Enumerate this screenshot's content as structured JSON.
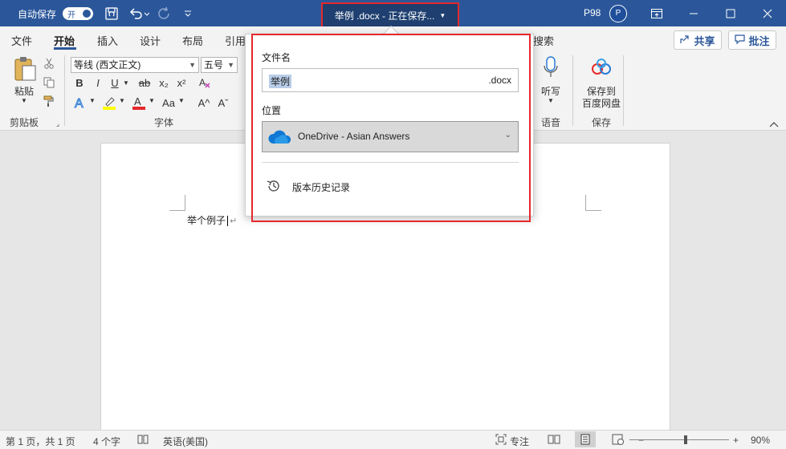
{
  "titlebar": {
    "autosave_label": "自动保存",
    "autosave_state": "开",
    "doc_title": "举例 .docx - 正在保存...",
    "user_name": "P98",
    "avatar_initial": "P"
  },
  "tabs": [
    "文件",
    "开始",
    "插入",
    "设计",
    "布局",
    "引用",
    "搜索"
  ],
  "active_tab": "开始",
  "share_label": "共享",
  "comment_label": "批注",
  "ribbon": {
    "paste_label": "粘贴",
    "clipboard_group": "剪贴板",
    "font_name": "等线 (西文正文)",
    "font_size": "五号",
    "font_group": "字体",
    "bold": "B",
    "italic": "I",
    "underline": "U",
    "strike": "ab",
    "subscript": "x₂",
    "superscript": "x²",
    "font_case": "Aa",
    "grow": "A^",
    "shrink": "Aˇ",
    "dictate_label": "听写",
    "voice_group": "语音",
    "baidu_save_line1": "保存到",
    "baidu_save_line2": "百度网盘",
    "save_group": "保存"
  },
  "popup": {
    "filename_label": "文件名",
    "filename_value": "举例",
    "filename_ext": ".docx",
    "location_label": "位置",
    "location_value": "OneDrive - Asian Answers",
    "history_label": "版本历史记录"
  },
  "document": {
    "text": "举个例子"
  },
  "statusbar": {
    "page": "第 1 页，共 1 页",
    "words": "4 个字",
    "language": "英语(美国)",
    "focus": "专注",
    "zoom": "90%",
    "zoom_percent": 90
  },
  "colors": {
    "title_blue": "#2b579a",
    "highlight_red": "#e5292b",
    "onedrive_blue": "#0f78d4"
  }
}
